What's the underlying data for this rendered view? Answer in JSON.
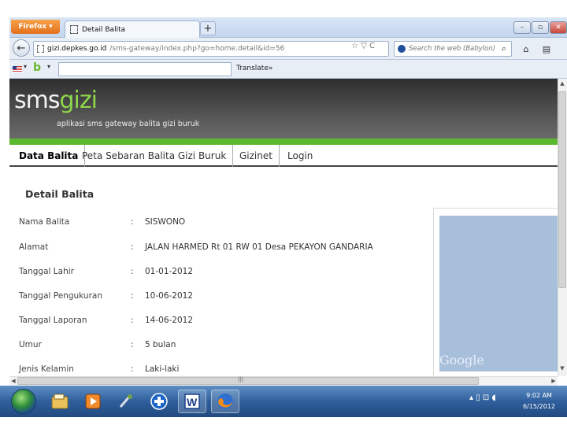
{
  "browser": {
    "app_button": "Firefox",
    "tab_title": "Detail Balita",
    "new_tab": "+",
    "window_controls": {
      "minimize": "–",
      "maximize": "▫",
      "close": "✕"
    },
    "url_host": "gizi.depkes.go.id",
    "url_path": "/sms-gateway/index.php?go=home.detail&id=56",
    "url_controls": "☆ ▽ C",
    "search_placeholder": "Search the web (Babylon)",
    "search_go": "⌕",
    "home_glyph": "⌂",
    "menu_glyph": "▤",
    "back_glyph": "←",
    "translate_button": "Translate»"
  },
  "site": {
    "logo_sms": "sms",
    "logo_gizi": "gizi",
    "tagline": "aplikasi sms gateway balita gizi buruk",
    "menu": [
      {
        "label": "Data Balita"
      },
      {
        "label": "Peta Sebaran Balita Gizi Buruk"
      },
      {
        "label": "Gizinet"
      },
      {
        "label": "Login"
      }
    ],
    "section_title": "Detail Balita",
    "separator": ":",
    "details": [
      {
        "label": "Nama Balita",
        "value": "SISWONO"
      },
      {
        "label": "Alamat",
        "value": "JALAN HARMED Rt 01 RW 01 Desa PEKAYON GANDARIA"
      },
      {
        "label": "Tanggal Lahir",
        "value": "01-01-2012"
      },
      {
        "label": "Tanggal Pengukuran",
        "value": "10-06-2012"
      },
      {
        "label": "Tanggal Laporan",
        "value": "14-06-2012"
      },
      {
        "label": "Umur",
        "value": "5 bulan"
      },
      {
        "label": "Jenis Kelamin",
        "value": "Laki-laki"
      }
    ],
    "map_brand": "Google"
  },
  "taskbar": {
    "apps": [
      "windows-explorer",
      "media-player",
      "tools",
      "plus-app",
      "word",
      "firefox"
    ],
    "clock_time": "9:02 AM",
    "clock_date": "6/15/2012",
    "tray_glyphs": "▴  ▯  ⊡  ◖"
  },
  "colors": {
    "brand_green": "#5ab82f",
    "logo_green": "#8ed64a",
    "header_dark": "#3a3a3a",
    "map_blue": "#a7bfdb"
  }
}
